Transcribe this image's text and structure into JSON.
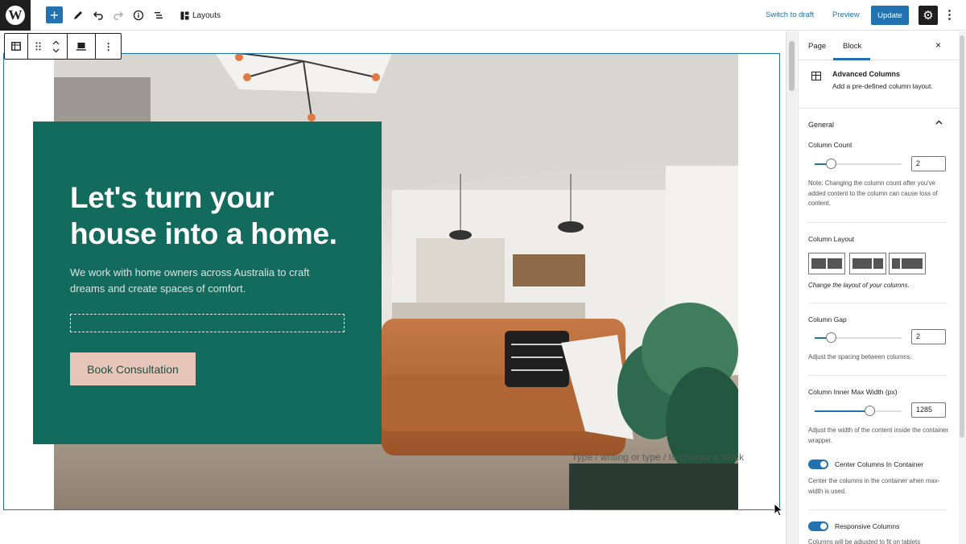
{
  "topbar": {
    "logo_letter": "W",
    "add_symbol": "+",
    "layouts_label": "Layouts",
    "switch_to_draft": "Switch to draft",
    "preview": "Preview",
    "update": "Update",
    "settings_symbol": "⚙",
    "more_symbol": "⋮"
  },
  "block_toolbar": {
    "more_symbol": "⋮"
  },
  "hero": {
    "title": "Let's turn your house into a home.",
    "subtitle": "We work with home owners across Australia to craft dreams and create spaces of comfort.",
    "button": "Book Consultation",
    "hint": "Type / writing or type / to choose a block"
  },
  "sidebar": {
    "tab_page": "Page",
    "tab_block": "Block",
    "close_symbol": "×",
    "block_name": "Advanced Columns",
    "block_description": "Add a pre-defined column layout.",
    "panel_title": "General",
    "column_count_label": "Column Count",
    "column_count_value": "2",
    "column_count_note": "Note: Changing the column count after you've added content to the column can cause loss of content.",
    "column_layout_label": "Column Layout",
    "column_layout_note": "Change the layout of your columns.",
    "column_gap_label": "Column Gap",
    "column_gap_value": "2",
    "column_gap_help": "Adjust the spacing between columns.",
    "inner_width_label": "Column Inner Max Width (px)",
    "inner_width_value": "1285",
    "inner_width_help": "Adjust the width of the content inside the container wrapper.",
    "center_label": "Center Columns In Container",
    "center_help": "Center the columns in the container when max-width is used.",
    "responsive_label": "Responsive Columns",
    "responsive_help": "Columns will be adjusted to fit on tablets"
  },
  "colors": {
    "accent": "#2271b1",
    "hero_bg": "#136b5d",
    "hero_button_bg": "#e7c5b8"
  }
}
